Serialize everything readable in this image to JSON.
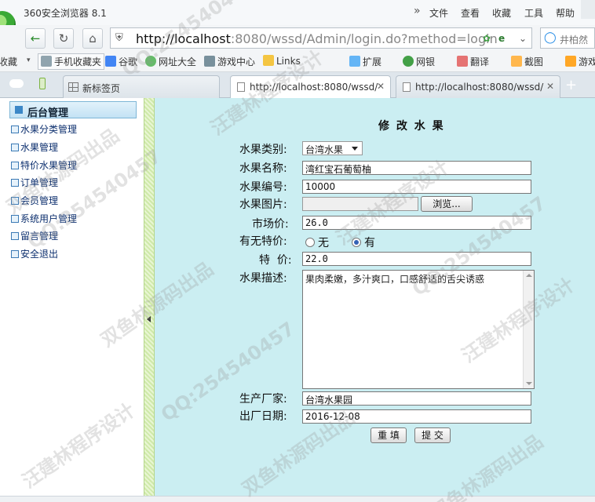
{
  "browser": {
    "title": "360安全浏览器 8.1",
    "menu": [
      "文件",
      "查看",
      "收藏",
      "工具",
      "帮助"
    ],
    "chevron": "»",
    "url_host": "http://localhost",
    "url_rest": ":8080/wssd/Admin/login.do?method=login",
    "search_placeholder": "井柏然"
  },
  "bookmarks": {
    "items": [
      "收藏",
      "手机收藏夹",
      "谷歌",
      "网址大全",
      "游戏中心",
      "Links"
    ],
    "right_items": [
      "扩展",
      "网银",
      "翻译",
      "截图",
      "游戏"
    ]
  },
  "tabs": [
    {
      "label": "新标签页",
      "icon": "grid-icon"
    },
    {
      "label": "http://localhost:8080/wssd/",
      "icon": "page-icon"
    },
    {
      "label": "http://localhost:8080/wssd/",
      "icon": "page-icon"
    }
  ],
  "sidebar": {
    "title": "后台管理",
    "items": [
      "水果分类管理",
      "水果管理",
      "特价水果管理",
      "订单管理",
      "会员管理",
      "系统用户管理",
      "留言管理",
      "安全退出"
    ]
  },
  "form": {
    "title": "修 改 水 果",
    "category_label": "水果类别:",
    "category_value": "台湾水果",
    "name_label": "水果名称:",
    "name_value": "湾红宝石葡萄柚",
    "code_label": "水果编号:",
    "code_value": "10000",
    "image_label": "水果图片:",
    "browse_button": "浏览...",
    "price_label": "市场价:",
    "price_value": "26.0",
    "special_label": "有无特价:",
    "radio_no": "无",
    "radio_yes": "有",
    "special_price_label": "特  价:",
    "special_price_value": "22.0",
    "desc_label": "水果描述:",
    "desc_value": "果肉柔嫩，多汁爽口，口感舒适的舌尖诱惑",
    "maker_label": "生产厂家:",
    "maker_value": "台湾水果园",
    "date_label": "出厂日期:",
    "date_value": "2016-12-08",
    "reset_button": "重 填",
    "submit_button": "提 交"
  },
  "watermark": [
    "QQ:2545404",
    "汪建林程序设计",
    "双鱼林源码出品",
    "QQ:254540457",
    "汪建林程序设计",
    "双鱼林源码出品",
    "QQ:254540457",
    "双鱼林源码出品",
    "汪建林程序设计",
    "QQ:254540457",
    "汪建林程序设计",
    "双鱼林源码出品"
  ]
}
